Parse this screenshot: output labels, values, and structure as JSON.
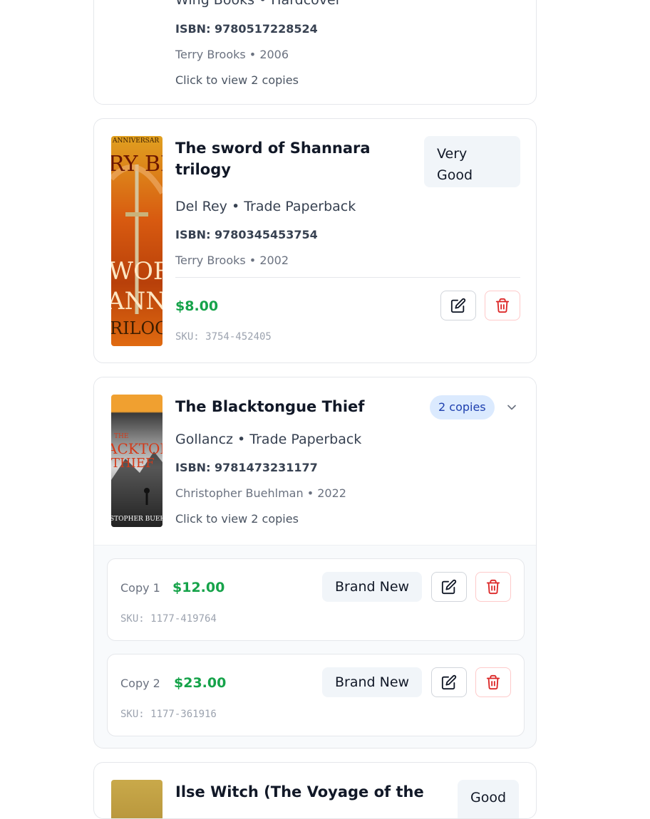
{
  "books": [
    {
      "publisher_line": "Wing Books • Hardcover",
      "isbn": "ISBN: 9780517228524",
      "author_year": "Terry Brooks • 2006",
      "copies_hint": "Click to view 2 copies"
    },
    {
      "title": "The sword of Shannara trilogy",
      "condition_line1": "Very",
      "condition_line2": "Good",
      "publisher_line": "Del Rey • Trade Paperback",
      "isbn": "ISBN: 9780345453754",
      "author_year": "Terry Brooks • 2002",
      "price": "$8.00",
      "sku": "SKU: 3754-452405",
      "cover_text": [
        "ANNIVERSAR",
        "RY BRO",
        "WOR",
        "ANNA",
        "RILOG"
      ]
    },
    {
      "title": "The Blacktongue Thief",
      "copies_badge": "2 copies",
      "publisher_line": "Gollancz • Trade Paperback",
      "isbn": "ISBN: 9781473231177",
      "author_year": "Christopher Buehlman • 2022",
      "copies_hint": "Click to view 2 copies",
      "cover_text": [
        "THE",
        "ACKTONG",
        "THIEF",
        "STOPHER BUEHL"
      ],
      "copies": [
        {
          "label": "Copy 1",
          "price": "$12.00",
          "condition": "Brand New",
          "sku": "SKU: 1177-419764"
        },
        {
          "label": "Copy 2",
          "price": "$23.00",
          "condition": "Brand New",
          "sku": "SKU: 1177-361916"
        }
      ]
    },
    {
      "title": "Ilse Witch (The Voyage of the",
      "condition": "Good"
    }
  ],
  "colors": {
    "price_green": "#16a34a",
    "delete_red": "#dc2626",
    "badge_blue_bg": "#dbeafe",
    "badge_blue_text": "#1e40af",
    "condition_bg": "#f1f5f9"
  },
  "icons": {
    "edit": "pencil-square-icon",
    "delete": "trash-icon",
    "expand": "chevron-down-icon"
  }
}
